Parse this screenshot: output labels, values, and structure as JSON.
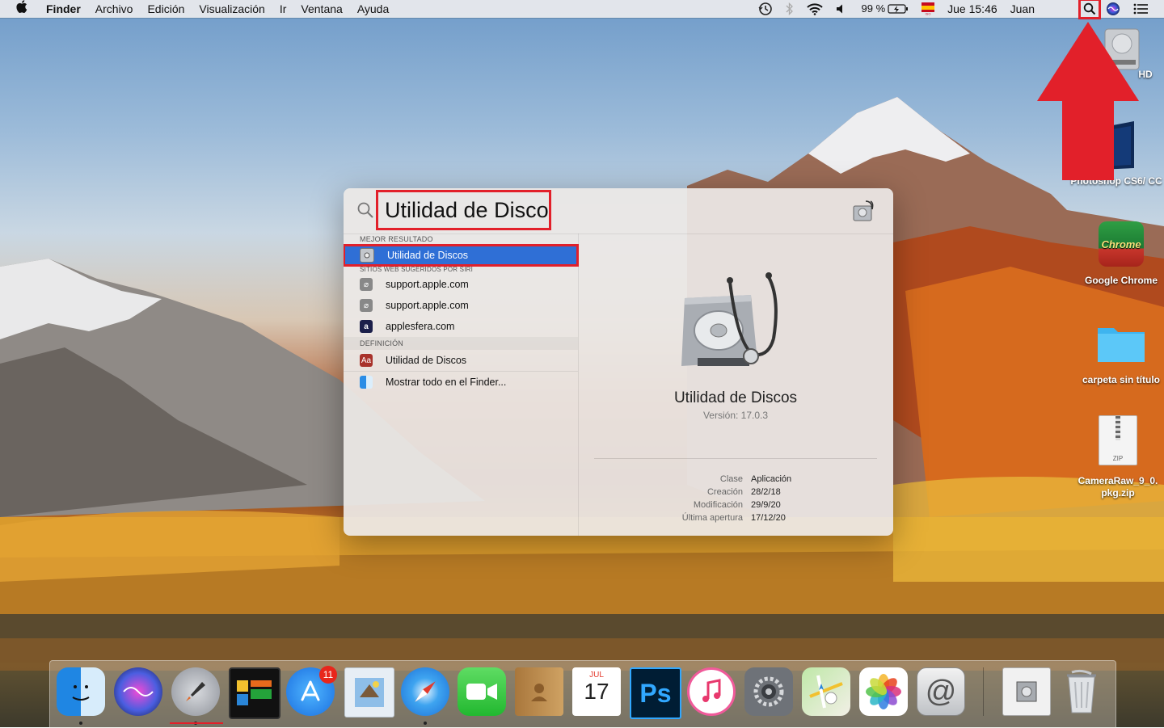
{
  "menubar": {
    "app_name": "Finder",
    "menus": [
      "Archivo",
      "Edición",
      "Visualización",
      "Ir",
      "Ventana",
      "Ayuda"
    ],
    "battery": "99 %",
    "clock": "Jue 15:46",
    "user": "Juan"
  },
  "spotlight": {
    "query": "Utilidad de Discos",
    "sections": {
      "best": "MEJOR RESULTADO",
      "siri": "SITIOS WEB SUGERIDOS POR SIRI",
      "definition": "DEFINICIÓN"
    },
    "best_result": "Utilidad de Discos",
    "siri_sites": [
      "support.apple.com",
      "support.apple.com",
      "applesfera.com"
    ],
    "definition_item": "Utilidad de Discos",
    "show_all": "Mostrar todo en el Finder...",
    "preview": {
      "title": "Utilidad de Discos",
      "version": "Versión: 17.0.3",
      "meta": [
        {
          "key": "Clase",
          "value": "Aplicación"
        },
        {
          "key": "Creación",
          "value": "28/2/18"
        },
        {
          "key": "Modificación",
          "value": "29/9/20"
        },
        {
          "key": "Última apertura",
          "value": "17/12/20"
        }
      ]
    }
  },
  "desktop_icons": {
    "hd": "HD",
    "photoshop": "Photoshop CS6/ CC",
    "chrome": "Google Chrome",
    "chrome_word": "Chrome",
    "folder": "carpeta sin título",
    "zip": "CameraRaw_9_0.pkg.zip",
    "zip_badge": "ZIP"
  },
  "dock": {
    "appstore_badge": "11",
    "calendar_month": "JUL",
    "calendar_day": "17",
    "ps": "Ps",
    "mail_at": "@"
  },
  "colors": {
    "highlight_red": "#e2202a",
    "selection_blue": "#2f6fd6"
  }
}
